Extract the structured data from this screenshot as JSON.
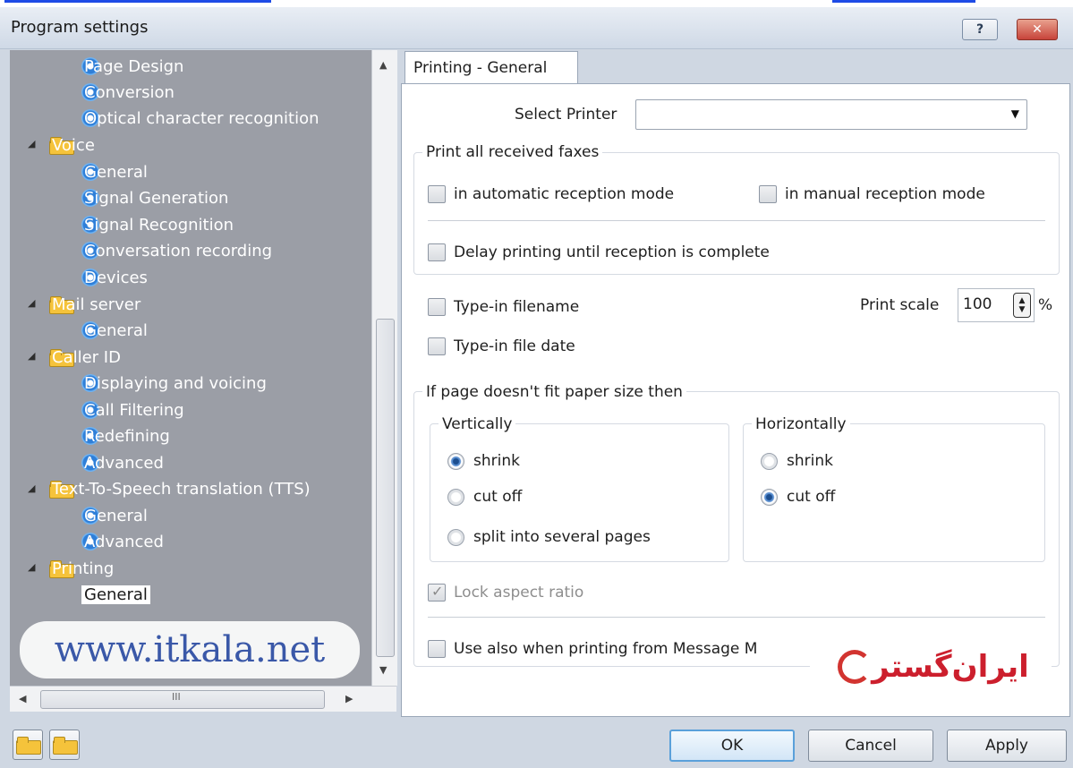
{
  "window": {
    "title": "Program settings",
    "help_glyph": "?",
    "close_glyph": "✕"
  },
  "tree": {
    "items": [
      {
        "label": "Page Design",
        "icon": "gear-icon",
        "level": 2
      },
      {
        "label": "Conversion",
        "icon": "gear-icon",
        "level": 2
      },
      {
        "label": "Optical character recognition",
        "icon": "gear-icon",
        "level": 2
      },
      {
        "label": "Voice",
        "icon": "folder-icon",
        "level": 1
      },
      {
        "label": "General",
        "icon": "gear-icon",
        "level": 2
      },
      {
        "label": "Signal Generation",
        "icon": "gear-icon",
        "level": 2
      },
      {
        "label": "Signal Recognition",
        "icon": "gear-icon",
        "level": 2
      },
      {
        "label": "Conversation recording",
        "icon": "gear-icon",
        "level": 2
      },
      {
        "label": "Devices",
        "icon": "gear-icon",
        "level": 2
      },
      {
        "label": "Mail server",
        "icon": "folder-icon",
        "level": 1
      },
      {
        "label": "General",
        "icon": "gear-icon",
        "level": 2
      },
      {
        "label": "Caller ID",
        "icon": "folder-icon",
        "level": 1
      },
      {
        "label": "Displaying and voicing",
        "icon": "gear-icon",
        "level": 2
      },
      {
        "label": "Call Filtering",
        "icon": "gear-icon",
        "level": 2
      },
      {
        "label": "Redefining",
        "icon": "gear-icon",
        "level": 2
      },
      {
        "label": "Advanced",
        "icon": "gear-icon",
        "level": 2
      },
      {
        "label": "Text-To-Speech translation (TTS)",
        "icon": "folder-icon",
        "level": 1
      },
      {
        "label": "General",
        "icon": "gear-icon",
        "level": 2
      },
      {
        "label": "Advanced",
        "icon": "gear-icon",
        "level": 2
      },
      {
        "label": "Printing",
        "icon": "folder-icon",
        "level": 1
      },
      {
        "label": "General",
        "icon": "gear-icon",
        "level": 2,
        "selected": true
      }
    ],
    "hscroll_grip": "III"
  },
  "tab": {
    "label": "Printing - General"
  },
  "printer": {
    "label": "Select Printer",
    "value": ""
  },
  "print_all": {
    "title": "Print all received faxes",
    "auto_label": "in automatic reception mode",
    "auto_checked": false,
    "manual_label": "in manual reception mode",
    "manual_checked": false,
    "delay_label": "Delay printing until reception is complete",
    "delay_checked": false
  },
  "typein_filename": {
    "label": "Type-in filename",
    "checked": false
  },
  "typein_filedate": {
    "label": "Type-in file date",
    "checked": false
  },
  "print_scale": {
    "label": "Print scale",
    "value": "100",
    "unit": "%"
  },
  "fit": {
    "title": "If page doesn't fit paper size then",
    "vertically": {
      "title": "Vertically",
      "options": [
        "shrink",
        "cut off",
        "split into several pages"
      ],
      "selected": "shrink"
    },
    "horizontally": {
      "title": "Horizontally",
      "options": [
        "shrink",
        "cut off"
      ],
      "selected": "cut off"
    },
    "lock_label": "Lock aspect ratio",
    "lock_checked": true
  },
  "use_also": {
    "label": "Use also when printing from Message M",
    "checked": false
  },
  "buttons": {
    "ok": "OK",
    "cancel": "Cancel",
    "apply": "Apply"
  },
  "watermark": {
    "text": "www.itkala.net"
  },
  "logo": {
    "text": "ایران‌گستر"
  },
  "colors": {
    "title_bar": "#d9e2ee",
    "tree_bg": "#9b9ea6",
    "close_red": "#c7443a",
    "ok_border": "#5aa0da"
  }
}
